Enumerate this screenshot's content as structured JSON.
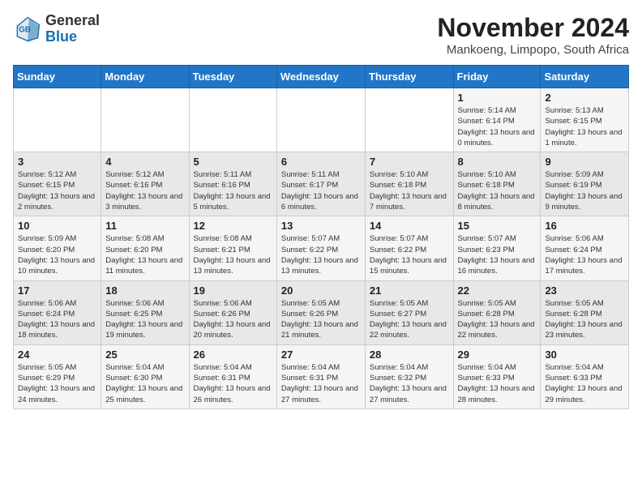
{
  "logo": {
    "general": "General",
    "blue": "Blue"
  },
  "header": {
    "month_title": "November 2024",
    "location": "Mankoeng, Limpopo, South Africa"
  },
  "weekdays": [
    "Sunday",
    "Monday",
    "Tuesday",
    "Wednesday",
    "Thursday",
    "Friday",
    "Saturday"
  ],
  "weeks": [
    [
      {
        "day": "",
        "info": ""
      },
      {
        "day": "",
        "info": ""
      },
      {
        "day": "",
        "info": ""
      },
      {
        "day": "",
        "info": ""
      },
      {
        "day": "",
        "info": ""
      },
      {
        "day": "1",
        "info": "Sunrise: 5:14 AM\nSunset: 6:14 PM\nDaylight: 13 hours and 0 minutes."
      },
      {
        "day": "2",
        "info": "Sunrise: 5:13 AM\nSunset: 6:15 PM\nDaylight: 13 hours and 1 minute."
      }
    ],
    [
      {
        "day": "3",
        "info": "Sunrise: 5:12 AM\nSunset: 6:15 PM\nDaylight: 13 hours and 2 minutes."
      },
      {
        "day": "4",
        "info": "Sunrise: 5:12 AM\nSunset: 6:16 PM\nDaylight: 13 hours and 3 minutes."
      },
      {
        "day": "5",
        "info": "Sunrise: 5:11 AM\nSunset: 6:16 PM\nDaylight: 13 hours and 5 minutes."
      },
      {
        "day": "6",
        "info": "Sunrise: 5:11 AM\nSunset: 6:17 PM\nDaylight: 13 hours and 6 minutes."
      },
      {
        "day": "7",
        "info": "Sunrise: 5:10 AM\nSunset: 6:18 PM\nDaylight: 13 hours and 7 minutes."
      },
      {
        "day": "8",
        "info": "Sunrise: 5:10 AM\nSunset: 6:18 PM\nDaylight: 13 hours and 8 minutes."
      },
      {
        "day": "9",
        "info": "Sunrise: 5:09 AM\nSunset: 6:19 PM\nDaylight: 13 hours and 9 minutes."
      }
    ],
    [
      {
        "day": "10",
        "info": "Sunrise: 5:09 AM\nSunset: 6:20 PM\nDaylight: 13 hours and 10 minutes."
      },
      {
        "day": "11",
        "info": "Sunrise: 5:08 AM\nSunset: 6:20 PM\nDaylight: 13 hours and 11 minutes."
      },
      {
        "day": "12",
        "info": "Sunrise: 5:08 AM\nSunset: 6:21 PM\nDaylight: 13 hours and 13 minutes."
      },
      {
        "day": "13",
        "info": "Sunrise: 5:07 AM\nSunset: 6:22 PM\nDaylight: 13 hours and 13 minutes."
      },
      {
        "day": "14",
        "info": "Sunrise: 5:07 AM\nSunset: 6:22 PM\nDaylight: 13 hours and 15 minutes."
      },
      {
        "day": "15",
        "info": "Sunrise: 5:07 AM\nSunset: 6:23 PM\nDaylight: 13 hours and 16 minutes."
      },
      {
        "day": "16",
        "info": "Sunrise: 5:06 AM\nSunset: 6:24 PM\nDaylight: 13 hours and 17 minutes."
      }
    ],
    [
      {
        "day": "17",
        "info": "Sunrise: 5:06 AM\nSunset: 6:24 PM\nDaylight: 13 hours and 18 minutes."
      },
      {
        "day": "18",
        "info": "Sunrise: 5:06 AM\nSunset: 6:25 PM\nDaylight: 13 hours and 19 minutes."
      },
      {
        "day": "19",
        "info": "Sunrise: 5:06 AM\nSunset: 6:26 PM\nDaylight: 13 hours and 20 minutes."
      },
      {
        "day": "20",
        "info": "Sunrise: 5:05 AM\nSunset: 6:26 PM\nDaylight: 13 hours and 21 minutes."
      },
      {
        "day": "21",
        "info": "Sunrise: 5:05 AM\nSunset: 6:27 PM\nDaylight: 13 hours and 22 minutes."
      },
      {
        "day": "22",
        "info": "Sunrise: 5:05 AM\nSunset: 6:28 PM\nDaylight: 13 hours and 22 minutes."
      },
      {
        "day": "23",
        "info": "Sunrise: 5:05 AM\nSunset: 6:28 PM\nDaylight: 13 hours and 23 minutes."
      }
    ],
    [
      {
        "day": "24",
        "info": "Sunrise: 5:05 AM\nSunset: 6:29 PM\nDaylight: 13 hours and 24 minutes."
      },
      {
        "day": "25",
        "info": "Sunrise: 5:04 AM\nSunset: 6:30 PM\nDaylight: 13 hours and 25 minutes."
      },
      {
        "day": "26",
        "info": "Sunrise: 5:04 AM\nSunset: 6:31 PM\nDaylight: 13 hours and 26 minutes."
      },
      {
        "day": "27",
        "info": "Sunrise: 5:04 AM\nSunset: 6:31 PM\nDaylight: 13 hours and 27 minutes."
      },
      {
        "day": "28",
        "info": "Sunrise: 5:04 AM\nSunset: 6:32 PM\nDaylight: 13 hours and 27 minutes."
      },
      {
        "day": "29",
        "info": "Sunrise: 5:04 AM\nSunset: 6:33 PM\nDaylight: 13 hours and 28 minutes."
      },
      {
        "day": "30",
        "info": "Sunrise: 5:04 AM\nSunset: 6:33 PM\nDaylight: 13 hours and 29 minutes."
      }
    ]
  ]
}
